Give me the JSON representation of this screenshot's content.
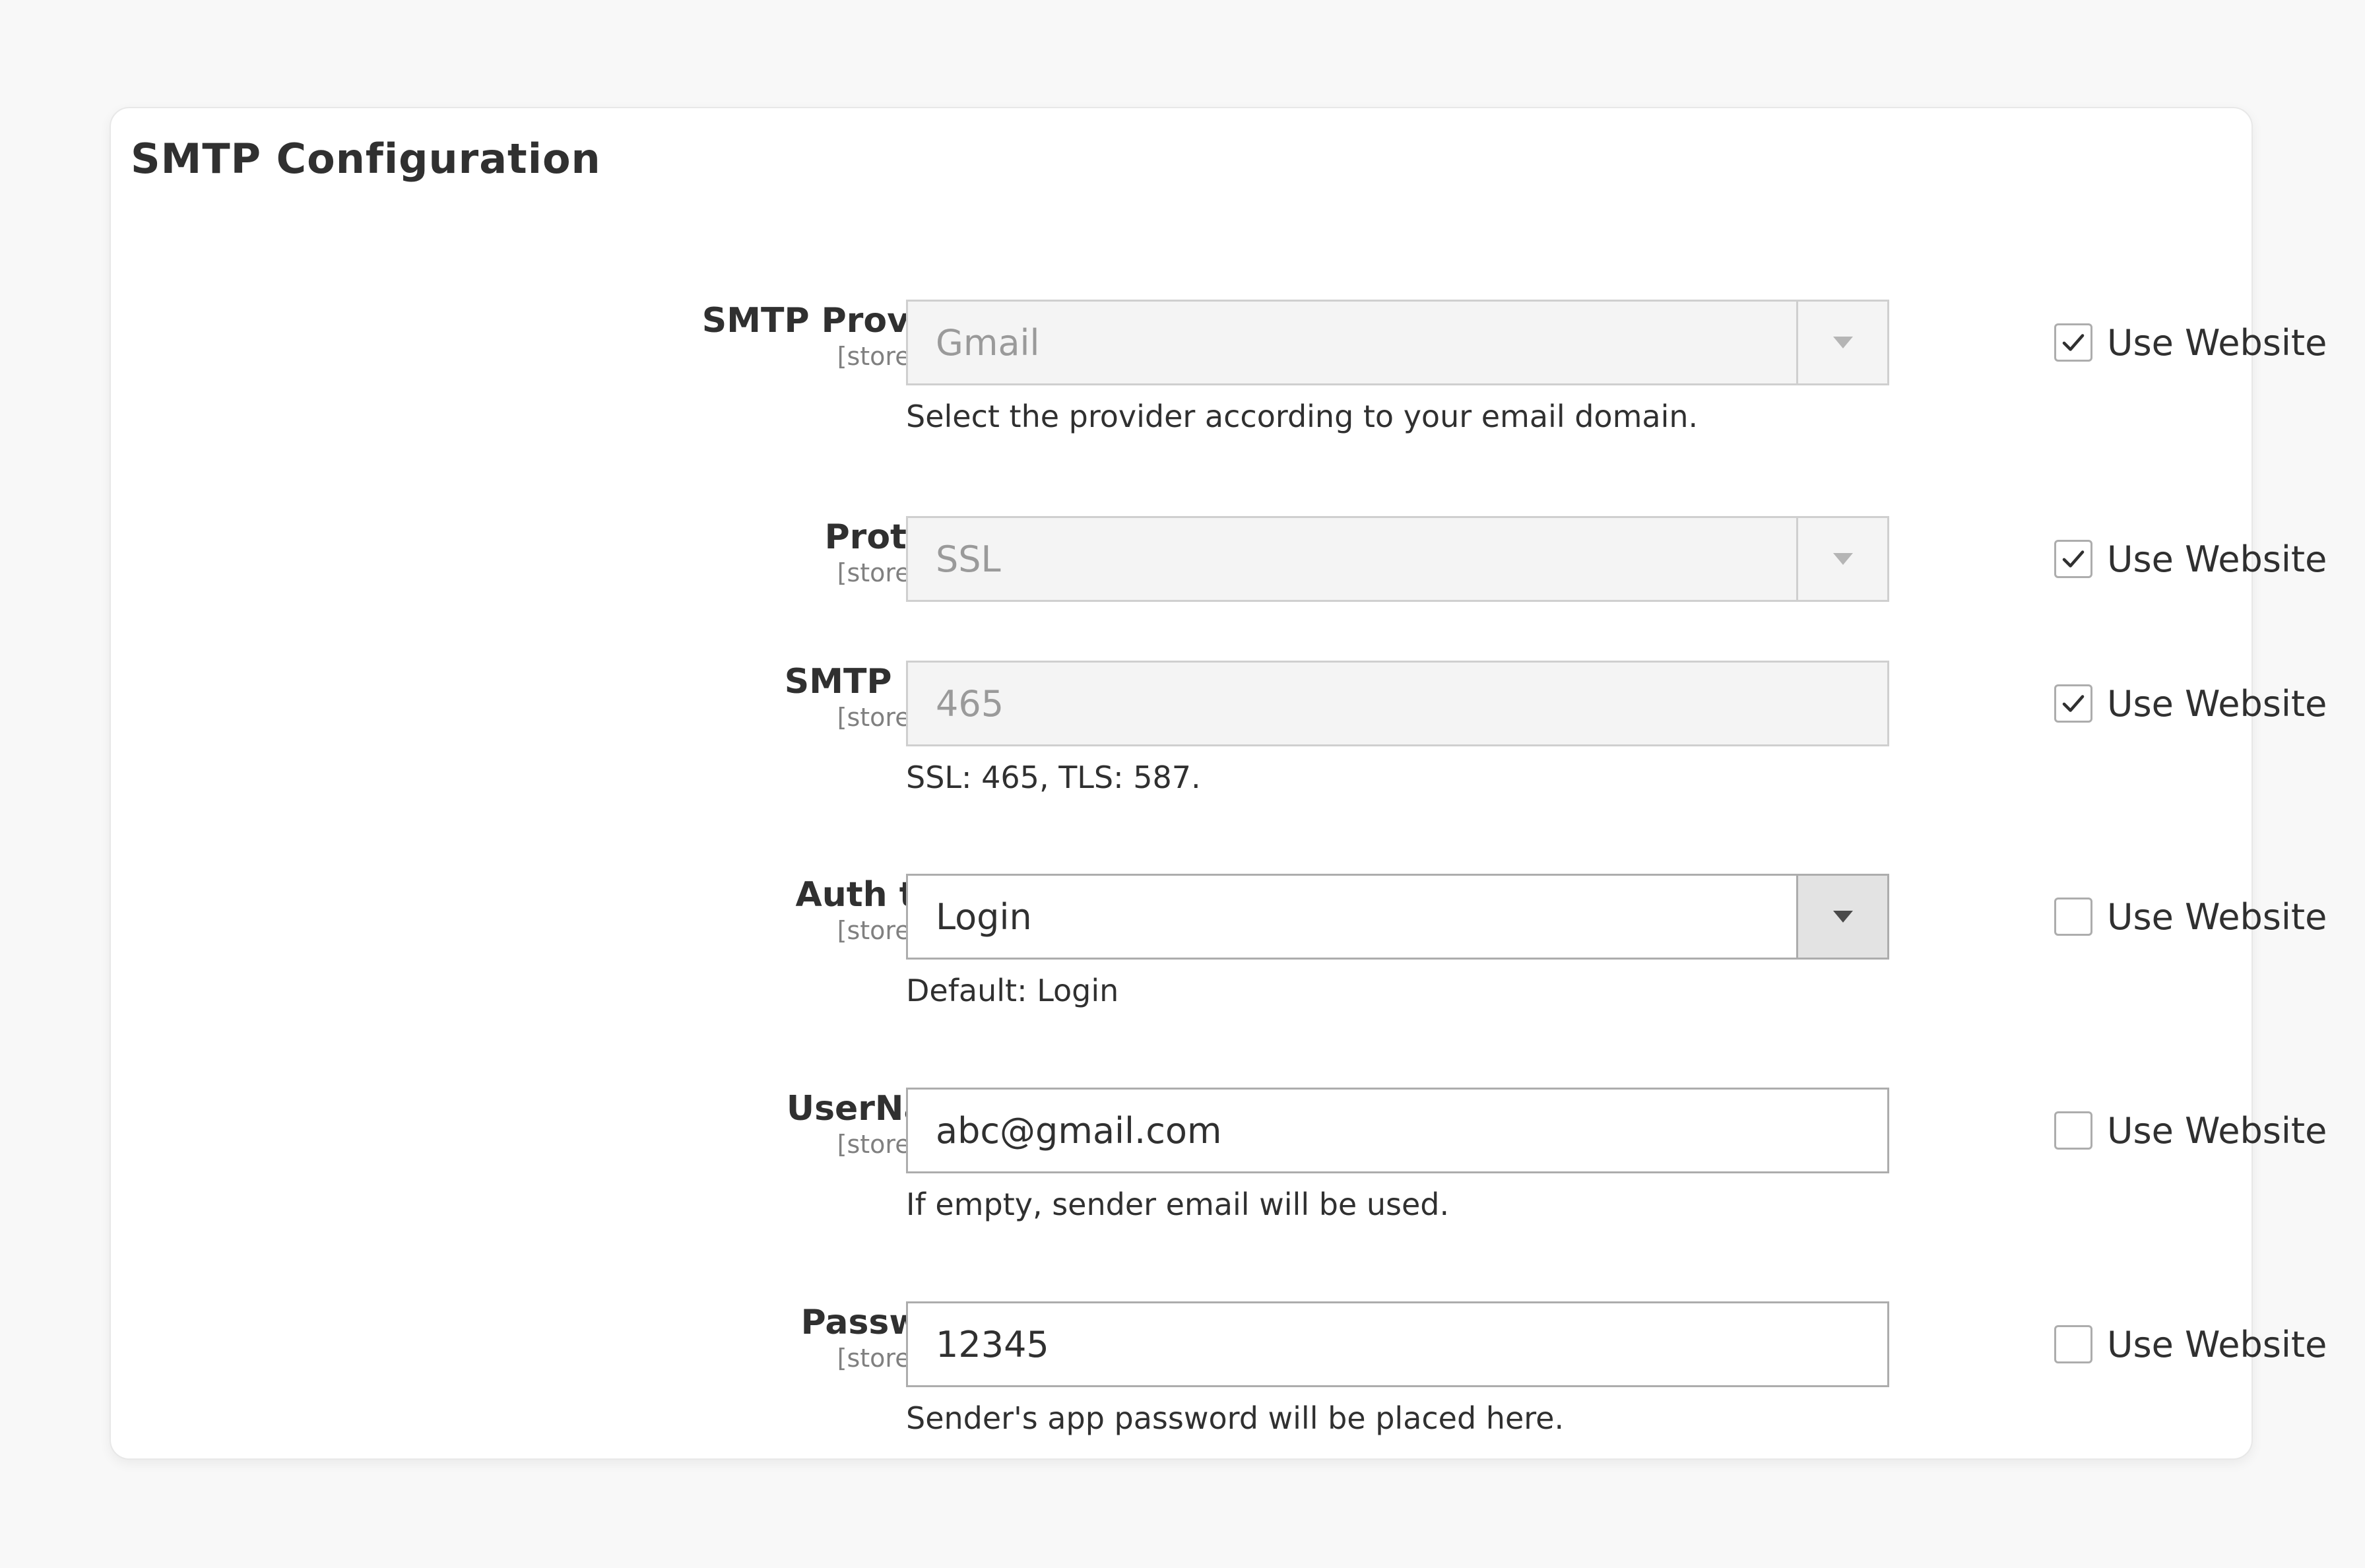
{
  "section": {
    "title": "SMTP Configuration"
  },
  "fields": [
    {
      "label": "SMTP Provider",
      "scope": "[store view]",
      "type": "select",
      "value": "Gmail",
      "disabled": true,
      "note": "Select the provider according to your email domain.",
      "use_website_label": "Use Website",
      "use_website_checked": true
    },
    {
      "label": "Protocol",
      "scope": "[store view]",
      "type": "select",
      "value": "SSL",
      "disabled": true,
      "note": "",
      "use_website_label": "Use Website",
      "use_website_checked": true
    },
    {
      "label": "SMTP Port",
      "scope": "[store view]",
      "type": "text",
      "value": "465",
      "disabled": true,
      "note": "SSL: 465, TLS: 587.",
      "use_website_label": "Use Website",
      "use_website_checked": true
    },
    {
      "label": "Auth type",
      "scope": "[store view]",
      "type": "select",
      "value": "Login",
      "disabled": false,
      "note": "Default: Login",
      "use_website_label": "Use Website",
      "use_website_checked": false
    },
    {
      "label": "UserName",
      "scope": "[store view]",
      "type": "text",
      "value": "abc@gmail.com",
      "disabled": false,
      "note": "If empty, sender email will be used.",
      "use_website_label": "Use Website",
      "use_website_checked": false
    },
    {
      "label": "Password",
      "scope": "[store view]",
      "type": "text",
      "value": "12345",
      "disabled": false,
      "note": "Sender's app password will be placed here.",
      "use_website_label": "Use Website",
      "use_website_checked": false
    }
  ]
}
